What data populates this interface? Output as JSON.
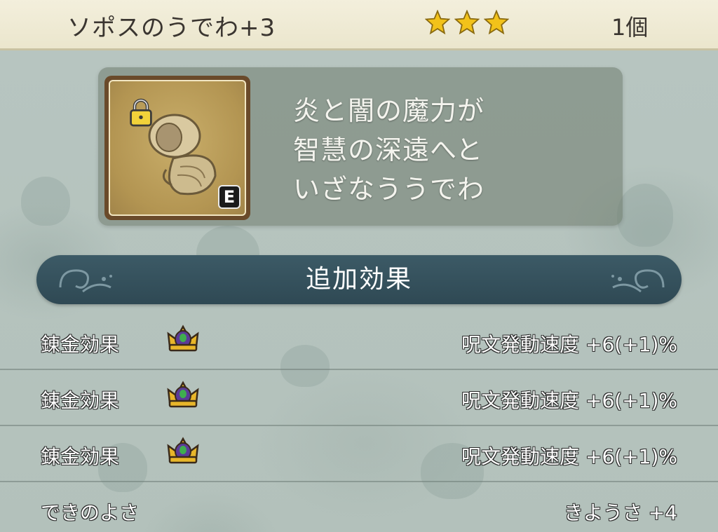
{
  "header": {
    "item_name": "ソポスのうでわ+3",
    "star_count": 3,
    "quantity": "1個"
  },
  "item": {
    "icon": "bracelet-icon",
    "locked": true,
    "equipped_badge": "E",
    "description_lines": [
      "炎と闇の魔力が",
      "智慧の深遠へと",
      "いざなううでわ"
    ]
  },
  "section": {
    "title": "追加効果"
  },
  "effects": [
    {
      "label": "錬金効果",
      "icon": "crown-icon",
      "effect": "呪文発動速度 +6(+1)%"
    },
    {
      "label": "錬金効果",
      "icon": "crown-icon",
      "effect": "呪文発動速度 +6(+1)%"
    },
    {
      "label": "錬金効果",
      "icon": "crown-icon",
      "effect": "呪文発動速度 +6(+1)%"
    }
  ],
  "quality": {
    "label": "できのよさ",
    "value": "きようさ +4"
  },
  "colors": {
    "header_bg": "#efead4",
    "banner_bg": "#355260",
    "star": "#f2c21a",
    "background": "#b4c2bd"
  }
}
